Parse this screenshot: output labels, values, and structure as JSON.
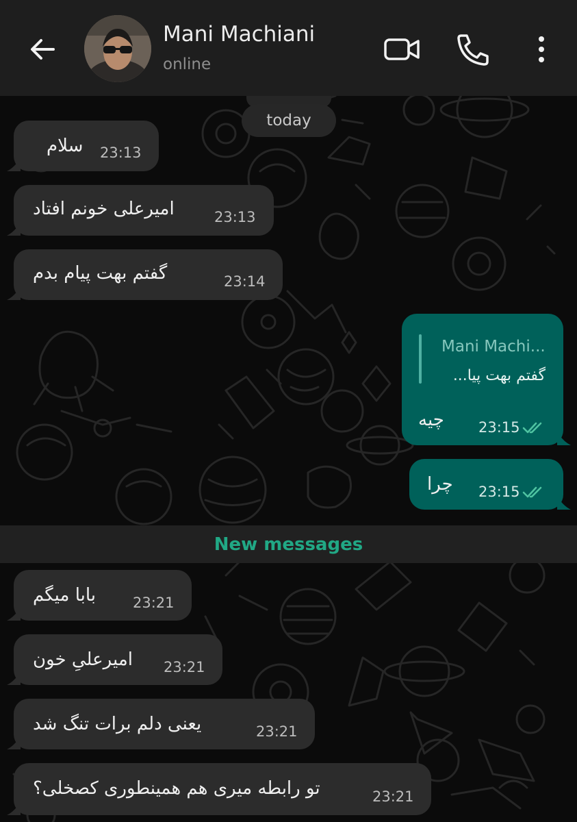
{
  "header": {
    "contact_name": "Mani Machiani",
    "status": "online",
    "icons": [
      "back-arrow-icon",
      "avatar",
      "video-call-icon",
      "phone-icon",
      "more-vertical-icon"
    ]
  },
  "chat": {
    "date_label": "today",
    "new_messages_label": "New messages",
    "messages_before": [
      {
        "text": "سلام",
        "time": "23:13"
      },
      {
        "text": "امیرعلی خونم افتاد",
        "time": "23:13"
      },
      {
        "text": "گفتم بهت پیام بدم",
        "time": "23:14"
      }
    ],
    "sent": [
      {
        "reply_name": "Mani Machi...",
        "reply_text": "گفتم بهت پیا...",
        "text": "چیه",
        "time": "23:15",
        "status": "read"
      },
      {
        "text": "چرا",
        "time": "23:15",
        "status": "read"
      }
    ],
    "messages_after": [
      {
        "text": "بابا میگم",
        "time": "23:21"
      },
      {
        "text": "امیرعلیِ خون",
        "time": "23:21"
      },
      {
        "text": "یعنی دلم برات تنگ شد",
        "time": "23:21"
      },
      {
        "text": "تو رابطه میری هم همینطوری کصخلی؟",
        "time": "23:21"
      }
    ]
  },
  "colors": {
    "header_bg": "#1e1e1e",
    "incoming_bubble": "#2c2c2c",
    "outgoing_bubble": "#00615a",
    "new_messages_text": "#21a885",
    "read_checks": "#4fc3a1"
  }
}
